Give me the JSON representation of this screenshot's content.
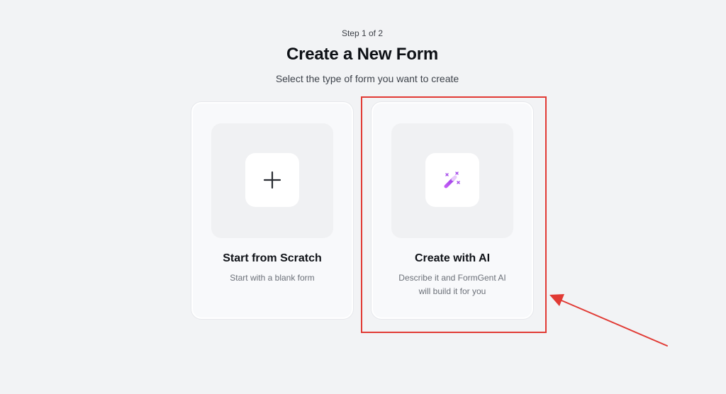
{
  "header": {
    "step": "Step 1 of 2",
    "title": "Create a New Form",
    "subtitle": "Select the type of form you want to create"
  },
  "options": [
    {
      "title": "Start from Scratch",
      "description": "Start with a blank form",
      "icon": "plus-icon"
    },
    {
      "title": "Create with AI",
      "description": "Describe it and FormGent AI\nwill build it for you",
      "icon": "magic-wand-icon"
    }
  ],
  "annotation": {
    "highlight_color": "#e13a34",
    "target": "Create with AI"
  },
  "colors": {
    "background": "#f2f3f5",
    "card": "#f8f9fb",
    "ai_accent": "#b34df0"
  }
}
